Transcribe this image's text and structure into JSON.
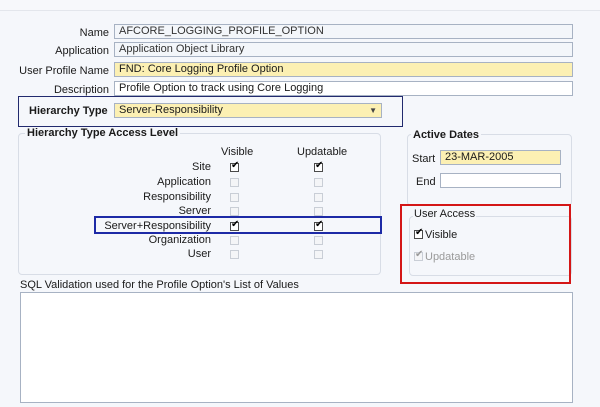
{
  "form": {
    "name_label": "Name",
    "name_value": "AFCORE_LOGGING_PROFILE_OPTION",
    "application_label": "Application",
    "application_value": "Application Object Library",
    "user_profile_name_label": "User Profile Name",
    "user_profile_name_value": "FND: Core Logging Profile Option",
    "description_label": "Description",
    "description_value": "Profile Option to track using Core Logging"
  },
  "hierarchy": {
    "label": "Hierarchy Type",
    "value": "Server-Responsibility",
    "dropdown_icon": "chevron-down-icon"
  },
  "access_level": {
    "title": "Hierarchy Type Access Level",
    "col_visible": "Visible",
    "col_updatable": "Updatable",
    "rows": [
      {
        "label": "Site",
        "visible": true,
        "updatable": true,
        "enabled": true
      },
      {
        "label": "Application",
        "visible": false,
        "updatable": false,
        "enabled": false
      },
      {
        "label": "Responsibility",
        "visible": false,
        "updatable": false,
        "enabled": false
      },
      {
        "label": "Server",
        "visible": false,
        "updatable": false,
        "enabled": false
      },
      {
        "label": "Server+Responsibility",
        "visible": true,
        "updatable": true,
        "enabled": true
      },
      {
        "label": "Organization",
        "visible": false,
        "updatable": false,
        "enabled": false
      },
      {
        "label": "User",
        "visible": false,
        "updatable": false,
        "enabled": false
      }
    ]
  },
  "active_dates": {
    "title": "Active Dates",
    "start_label": "Start",
    "start_value": "23-MAR-2005",
    "end_label": "End",
    "end_value": ""
  },
  "user_access": {
    "title": "User Access",
    "visible_label": "Visible",
    "visible_checked": true,
    "updatable_label": "Updatable",
    "updatable_checked": true
  },
  "sql": {
    "label": "SQL Validation used for the Profile Option's List of Values",
    "value": ""
  },
  "colors": {
    "highlight_blue": "#1d2aa6",
    "highlight_red": "#d41616",
    "required_field": "#fcf0b3"
  }
}
